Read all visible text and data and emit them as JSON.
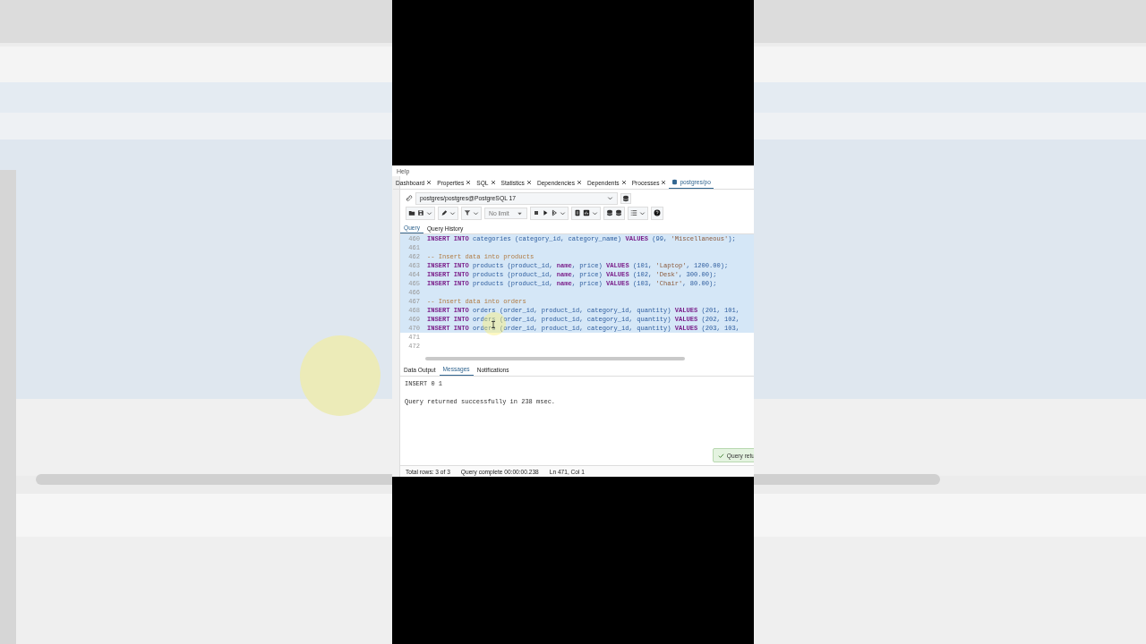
{
  "menu": [
    "Help"
  ],
  "tabs": [
    {
      "label": "Dashboard",
      "selected": false
    },
    {
      "label": "Properties",
      "selected": false
    },
    {
      "label": "SQL",
      "selected": false
    },
    {
      "label": "Statistics",
      "selected": false
    },
    {
      "label": "Dependencies",
      "selected": false
    },
    {
      "label": "Dependents",
      "selected": false
    },
    {
      "label": "Processes",
      "selected": false
    },
    {
      "label": "postgres/po",
      "selected": true
    }
  ],
  "connection": {
    "value": "postgres/postgres@PostgreSQL 17"
  },
  "toolbar": {
    "limit": "No limit"
  },
  "editor_tabs": [
    {
      "label": "Query",
      "selected": true
    },
    {
      "label": "Query History",
      "selected": false
    }
  ],
  "lines": [
    {
      "number": "460",
      "highlighted": true,
      "segments": [
        {
          "kind": "keyword",
          "text": "INSERT INTO"
        },
        {
          "kind": "plain",
          "text": " categories (category_id, category_name) "
        },
        {
          "kind": "keyword",
          "text": "VALUES"
        },
        {
          "kind": "plain",
          "text": " (99, "
        },
        {
          "kind": "string",
          "text": "'Miscellaneous'"
        },
        {
          "kind": "plain",
          "text": ");"
        }
      ]
    },
    {
      "number": "461",
      "highlighted": true
    },
    {
      "number": "462",
      "highlighted": true,
      "segments": [
        {
          "kind": "comment",
          "text": "-- Insert data into products"
        }
      ]
    },
    {
      "number": "463",
      "highlighted": true,
      "segments": [
        {
          "kind": "keyword",
          "text": "INSERT INTO"
        },
        {
          "kind": "plain",
          "text": " products (product_id, "
        },
        {
          "kind": "keyword",
          "text": "name"
        },
        {
          "kind": "plain",
          "text": ", price) "
        },
        {
          "kind": "keyword",
          "text": "VALUES"
        },
        {
          "kind": "plain",
          "text": " (101, "
        },
        {
          "kind": "string",
          "text": "'Laptop'"
        },
        {
          "kind": "plain",
          "text": ", 1200.00);"
        }
      ]
    },
    {
      "number": "464",
      "highlighted": true,
      "segments": [
        {
          "kind": "keyword",
          "text": "INSERT INTO"
        },
        {
          "kind": "plain",
          "text": " products (product_id, "
        },
        {
          "kind": "keyword",
          "text": "name"
        },
        {
          "kind": "plain",
          "text": ", price) "
        },
        {
          "kind": "keyword",
          "text": "VALUES"
        },
        {
          "kind": "plain",
          "text": " (102, "
        },
        {
          "kind": "string",
          "text": "'Desk'"
        },
        {
          "kind": "plain",
          "text": ", 300.00);"
        }
      ]
    },
    {
      "number": "465",
      "highlighted": true,
      "segments": [
        {
          "kind": "keyword",
          "text": "INSERT INTO"
        },
        {
          "kind": "plain",
          "text": " products (product_id, "
        },
        {
          "kind": "keyword",
          "text": "name"
        },
        {
          "kind": "plain",
          "text": ", price) "
        },
        {
          "kind": "keyword",
          "text": "VALUES"
        },
        {
          "kind": "plain",
          "text": " (103, "
        },
        {
          "kind": "string",
          "text": "'Chair'"
        },
        {
          "kind": "plain",
          "text": ", 80.00);"
        }
      ]
    },
    {
      "number": "466",
      "highlighted": true
    },
    {
      "number": "467",
      "highlighted": true,
      "segments": [
        {
          "kind": "comment",
          "text": "-- Insert data into orders"
        }
      ]
    },
    {
      "number": "468",
      "highlighted": true,
      "segments": [
        {
          "kind": "keyword",
          "text": "INSERT INTO"
        },
        {
          "kind": "plain",
          "text": " orders (order_id, product_id, category_id, quantity) "
        },
        {
          "kind": "keyword",
          "text": "VALUES"
        },
        {
          "kind": "plain",
          "text": " (201, 101,"
        }
      ]
    },
    {
      "number": "469",
      "highlighted": true,
      "segments": [
        {
          "kind": "keyword",
          "text": "INSERT INTO"
        },
        {
          "kind": "plain",
          "text": " orders (order_id, product_id, category_id, quantity) "
        },
        {
          "kind": "keyword",
          "text": "VALUES"
        },
        {
          "kind": "plain",
          "text": " (202, 102,"
        }
      ]
    },
    {
      "number": "470",
      "highlighted": true,
      "segments": [
        {
          "kind": "keyword",
          "text": "INSERT INTO"
        },
        {
          "kind": "plain",
          "text": " orders (order_id, product_id, category_id, quantity) "
        },
        {
          "kind": "keyword",
          "text": "VALUES"
        },
        {
          "kind": "plain",
          "text": " (203, 103,"
        }
      ]
    },
    {
      "number": "471",
      "highlighted": false
    },
    {
      "number": "472",
      "highlighted": false
    }
  ],
  "result_tabs": [
    {
      "label": "Data Output",
      "selected": false
    },
    {
      "label": "Messages",
      "selected": true
    },
    {
      "label": "Notifications",
      "selected": false
    }
  ],
  "messages": [
    "INSERT 0 1",
    "Query returned successfully in 238 msec."
  ],
  "toast": {
    "text": "Query retu"
  },
  "status": [
    "Total rows: 3 of 3",
    "Query complete 00:00:00.238",
    "Ln 471, Col 1"
  ]
}
